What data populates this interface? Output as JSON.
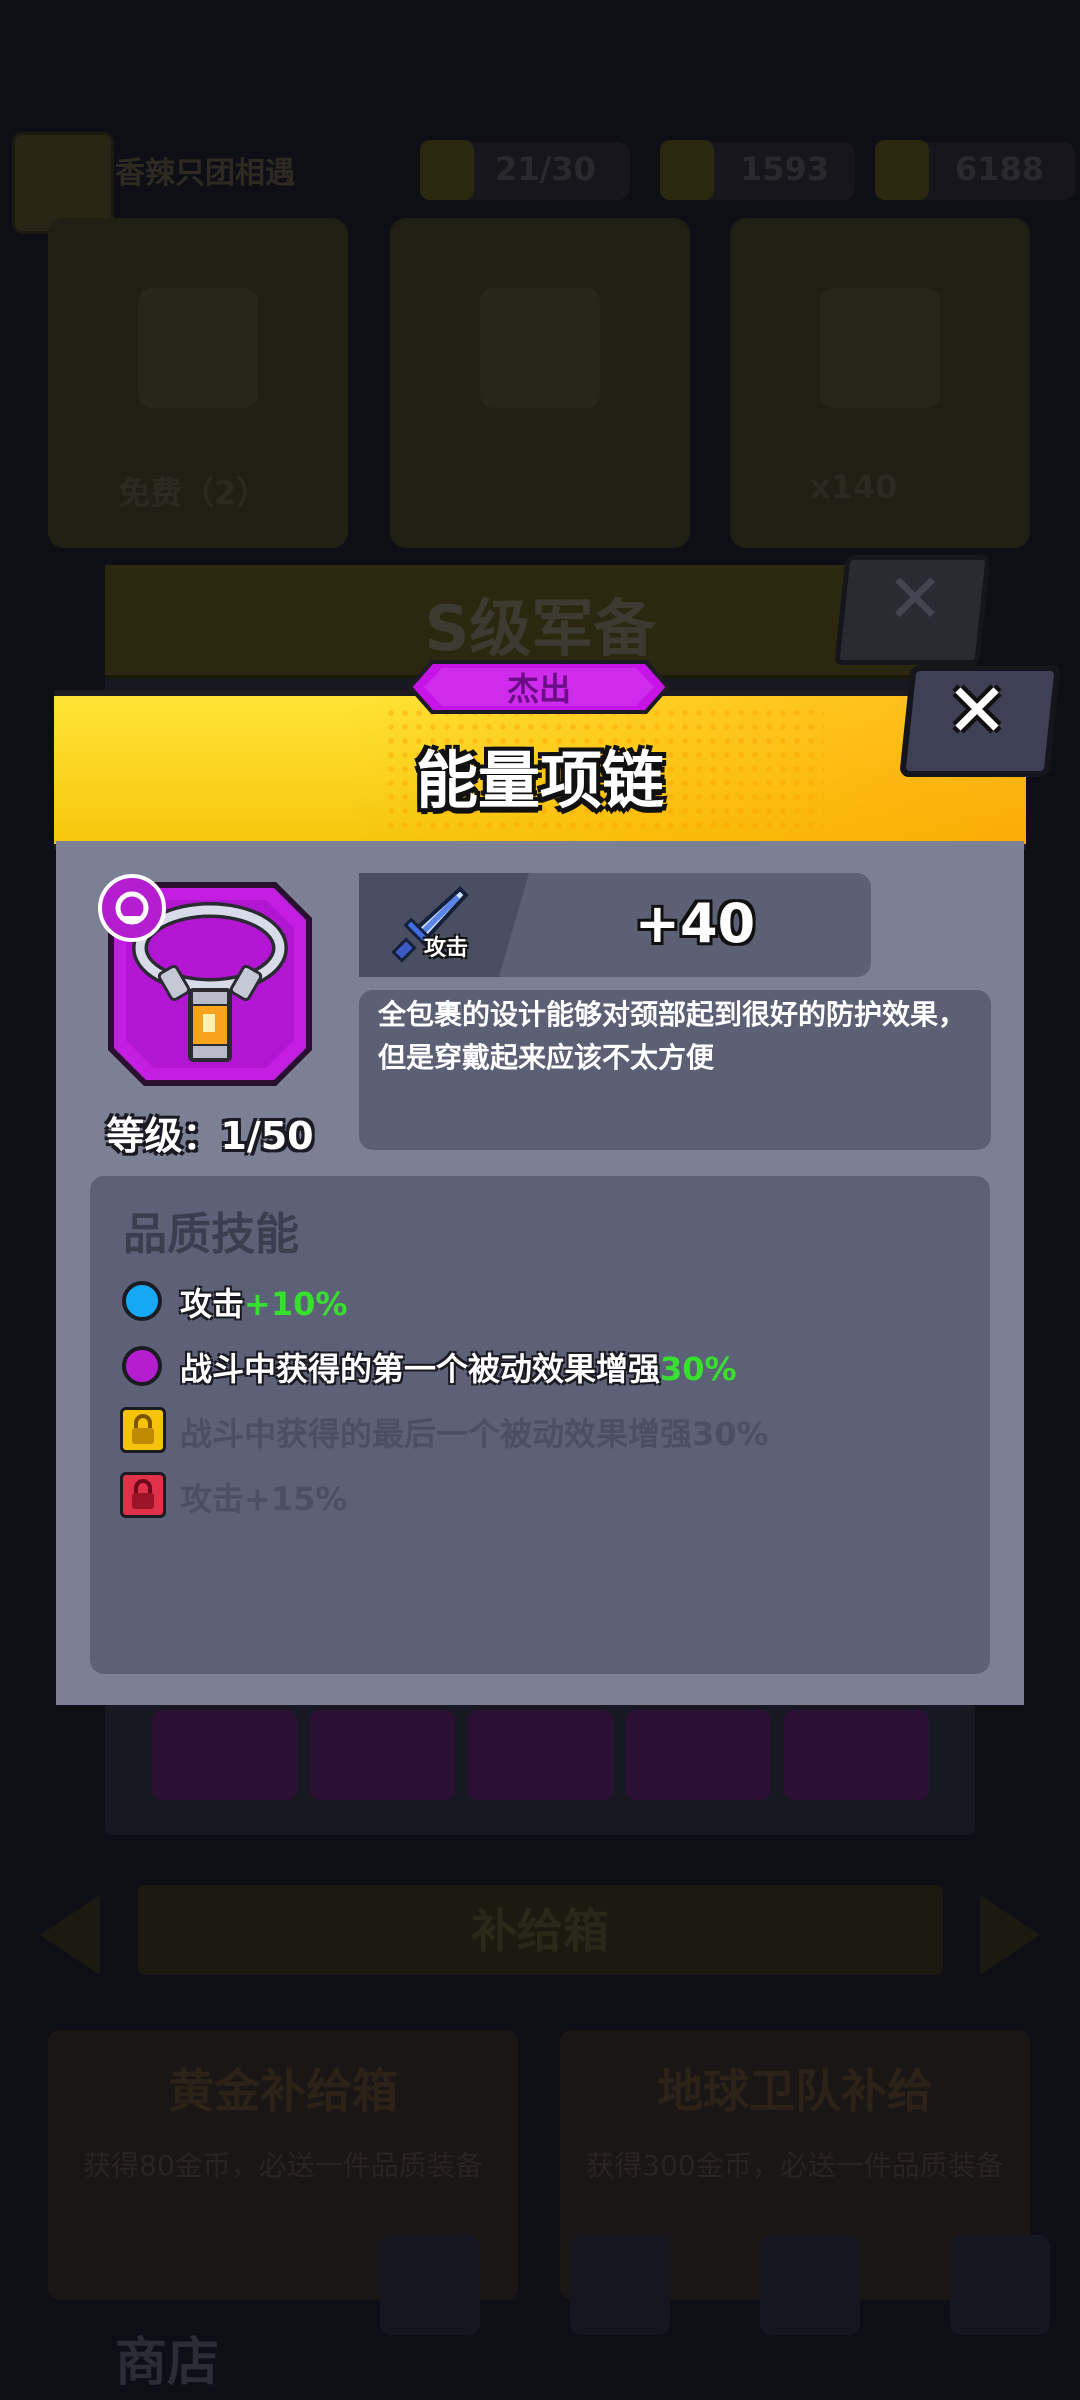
{
  "background": {
    "player_name": "香辣只团相遇",
    "resources": [
      "21/30",
      "1593",
      "6188"
    ],
    "card_free_label": "免费（2）",
    "card_cost": "x140",
    "panel_title": "S级军备",
    "supply_title": "补给箱",
    "offer_left_title": "黄金补给箱",
    "offer_left_desc": "获得80金币，必送一件品质装备",
    "offer_right_title": "地球卫队补给",
    "offer_right_desc": "获得300金币，必送一件品质装备",
    "shop_label": "商店"
  },
  "dialog": {
    "quality": "杰出",
    "title": "能量项链",
    "level": "等级：1/50",
    "stat": {
      "label": "攻击",
      "value": "+40",
      "icon": "sword-icon"
    },
    "description": "全包裹的设计能够对颈部起到很好的防护效果，但是穿戴起来应该不太方便",
    "skills_title": "品质技能",
    "skills": [
      {
        "prefix": "攻击",
        "bonus": "+10%",
        "state": "unlocked",
        "marker": "blue-dot-icon",
        "color": "#16a8f4"
      },
      {
        "prefix": "战斗中获得的第一个被动效果增强",
        "bonus": "30%",
        "state": "unlocked",
        "marker": "purple-dot-icon",
        "color": "#b41ed0"
      },
      {
        "text": "战斗中获得的最后一个被动效果增强30%",
        "state": "locked",
        "marker": "yellow-lock-icon",
        "color": "#f5c30c"
      },
      {
        "text": "攻击+15%",
        "state": "locked",
        "marker": "red-lock-icon",
        "color": "#e1314a"
      }
    ]
  },
  "colors": {
    "header_yellow": "#f6c60c",
    "quality_purple": "#c613e6",
    "body_gray": "#7c8095",
    "green_bonus": "#37e02e"
  }
}
